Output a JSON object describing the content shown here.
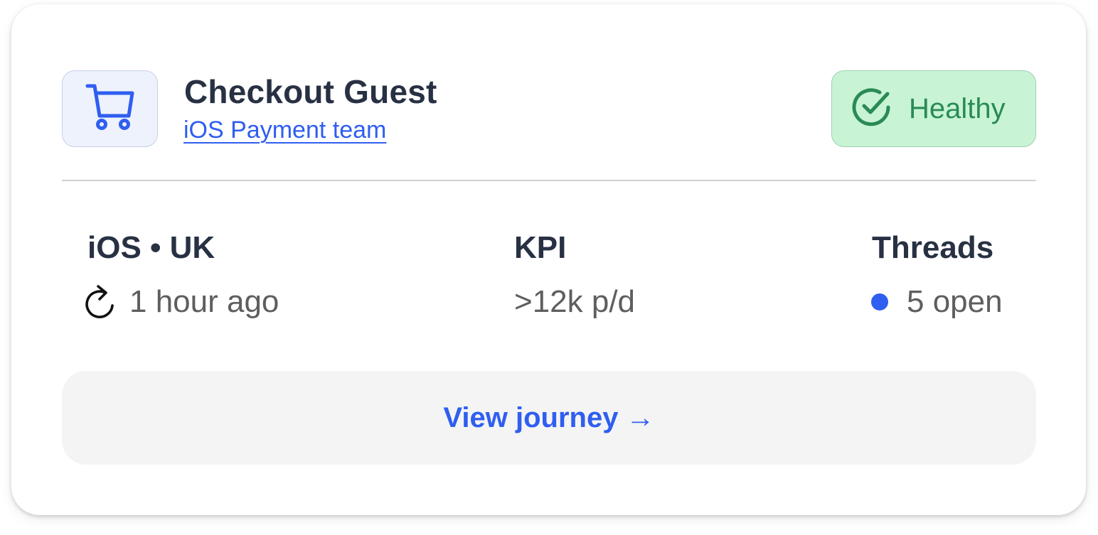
{
  "journey": {
    "title": "Checkout Guest",
    "team": "iOS Payment team",
    "icon": "shopping-cart-icon"
  },
  "status": {
    "label": "Healthy",
    "icon": "check-circle-icon",
    "color": "#2a8a55",
    "background": "#c8f4d5"
  },
  "stats": [
    {
      "heading": "iOS • UK",
      "value": "1 hour ago",
      "icon": "refresh-icon"
    },
    {
      "heading": "KPI",
      "value": ">12k p/d"
    },
    {
      "heading": "Threads",
      "value": "5 open",
      "icon": "blue-dot-icon",
      "dot_color": "#2f5ef0"
    }
  ],
  "action": {
    "label": "View journey →"
  },
  "colors": {
    "accent": "#2f5ef0",
    "heading": "#283143",
    "muted": "#5e5e5e"
  }
}
